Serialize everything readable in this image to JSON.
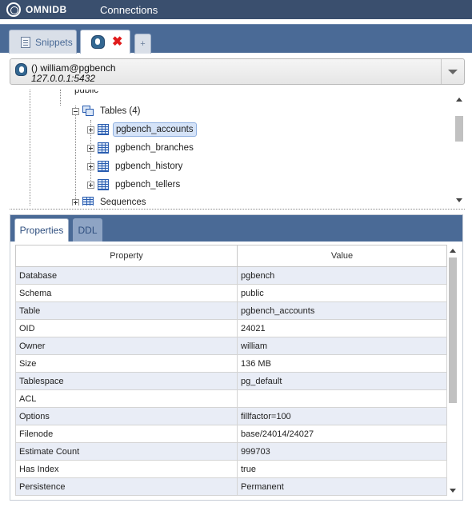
{
  "app": {
    "name": "OMNIDB",
    "nav_link": "Connections"
  },
  "tabs": {
    "snippets_label": "Snippets",
    "db_tab_icon": "postgresql-elephant-icon",
    "close_icon": "red-x",
    "add_label": "+"
  },
  "connection": {
    "name": "() william@pgbench",
    "host": "127.0.0.1:5432"
  },
  "tree": {
    "partial_top_label": "public",
    "tables_label": "Tables (4)",
    "tables": [
      {
        "label": "pgbench_accounts",
        "selected": true
      },
      {
        "label": "pgbench_branches",
        "selected": false
      },
      {
        "label": "pgbench_history",
        "selected": false
      },
      {
        "label": "pgbench_tellers",
        "selected": false
      }
    ],
    "partial_bottom_label": "Sequences"
  },
  "panel": {
    "tabs": [
      "Properties",
      "DDL"
    ],
    "active_tab": "Properties",
    "columns": [
      "Property",
      "Value"
    ],
    "rows": [
      [
        "Database",
        "pgbench"
      ],
      [
        "Schema",
        "public"
      ],
      [
        "Table",
        "pgbench_accounts"
      ],
      [
        "OID",
        "24021"
      ],
      [
        "Owner",
        "william"
      ],
      [
        "Size",
        "136 MB"
      ],
      [
        "Tablespace",
        "pg_default"
      ],
      [
        "ACL",
        ""
      ],
      [
        "Options",
        "fillfactor=100"
      ],
      [
        "Filenode",
        "base/24014/24027"
      ],
      [
        "Estimate Count",
        "999703"
      ],
      [
        "Has Index",
        "true"
      ],
      [
        "Persistence",
        "Permanent"
      ]
    ]
  },
  "colors": {
    "topbar": "#3a4f6e",
    "tabstrip": "#4a6a96",
    "row_alt": "#e9edf6",
    "close_red": "#e01b1b",
    "selection": "#d5e3f8"
  }
}
